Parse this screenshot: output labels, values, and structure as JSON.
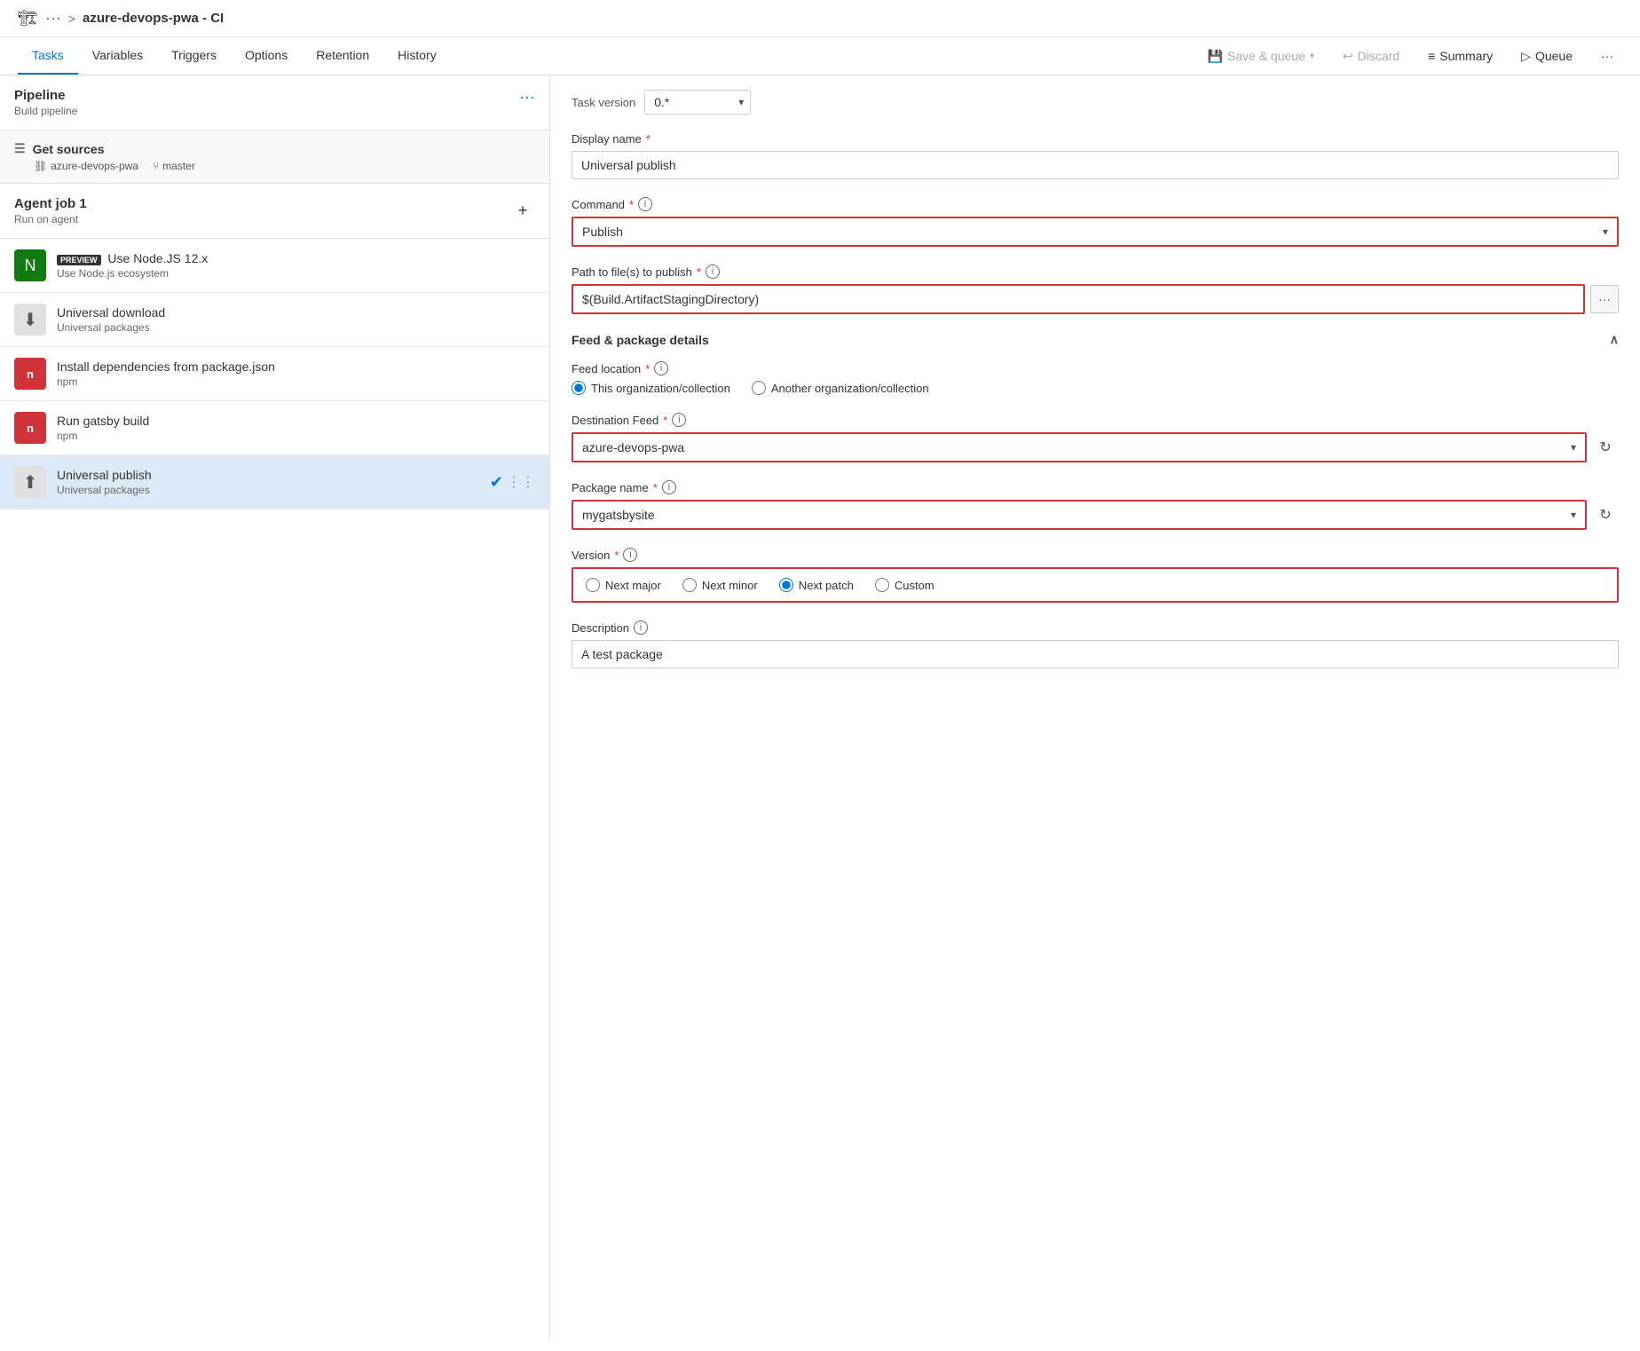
{
  "breadcrumb": {
    "icon": "🏠",
    "dots": "···",
    "separator": ">",
    "title": "azure-devops-pwa - CI"
  },
  "tabs": {
    "left": [
      {
        "id": "tasks",
        "label": "Tasks",
        "active": true
      },
      {
        "id": "variables",
        "label": "Variables",
        "active": false
      },
      {
        "id": "triggers",
        "label": "Triggers",
        "active": false
      },
      {
        "id": "options",
        "label": "Options",
        "active": false
      },
      {
        "id": "retention",
        "label": "Retention",
        "active": false
      },
      {
        "id": "history",
        "label": "History",
        "active": false
      }
    ],
    "right": [
      {
        "id": "save-queue",
        "label": "Save & queue",
        "icon": "💾",
        "disabled": true
      },
      {
        "id": "discard",
        "label": "Discard",
        "icon": "↩",
        "disabled": true
      },
      {
        "id": "summary",
        "label": "Summary",
        "icon": "≡"
      },
      {
        "id": "queue",
        "label": "Queue",
        "icon": "▷"
      },
      {
        "id": "more",
        "label": "···",
        "icon": ""
      }
    ]
  },
  "left_panel": {
    "pipeline": {
      "title": "Pipeline",
      "subtitle": "Build pipeline",
      "dots": "···"
    },
    "get_sources": {
      "title": "Get sources",
      "repo": "azure-devops-pwa",
      "branch": "master"
    },
    "agent_job": {
      "title": "Agent job 1",
      "subtitle": "Run on agent"
    },
    "tasks": [
      {
        "id": "nodejs",
        "name": "Use Node.JS 12.x",
        "subtitle": "Use Node.js ecosystem",
        "icon_type": "green",
        "icon": "N",
        "preview": true
      },
      {
        "id": "universal-download",
        "name": "Universal download",
        "subtitle": "Universal packages",
        "icon_type": "gray",
        "icon": "⬇",
        "preview": false
      },
      {
        "id": "install-deps",
        "name": "Install dependencies from package.json",
        "subtitle": "npm",
        "icon_type": "red",
        "icon": "n",
        "preview": false
      },
      {
        "id": "gatsby-build",
        "name": "Run gatsby build",
        "subtitle": "npm",
        "icon_type": "red",
        "icon": "n",
        "preview": false
      },
      {
        "id": "universal-publish",
        "name": "Universal publish",
        "subtitle": "Universal packages",
        "icon_type": "gray",
        "icon": "⬆",
        "preview": false,
        "active": true
      }
    ]
  },
  "right_panel": {
    "task_version_label": "Task version",
    "task_version_value": "0.*",
    "display_name_label": "Display name",
    "display_name_required": true,
    "display_name_value": "Universal publish",
    "command_label": "Command",
    "command_required": true,
    "command_value": "Publish",
    "path_label": "Path to file(s) to publish",
    "path_required": true,
    "path_value": "$(Build.ArtifactStagingDirectory)",
    "feed_section_title": "Feed & package details",
    "feed_location_label": "Feed location",
    "feed_location_required": true,
    "feed_location_options": [
      {
        "id": "this-org",
        "label": "This organization/collection",
        "checked": true
      },
      {
        "id": "another-org",
        "label": "Another organization/collection",
        "checked": false
      }
    ],
    "destination_feed_label": "Destination Feed",
    "destination_feed_required": true,
    "destination_feed_value": "azure-devops-pwa",
    "package_name_label": "Package name",
    "package_name_required": true,
    "package_name_value": "mygatsbysite",
    "version_label": "Version",
    "version_required": true,
    "version_options": [
      {
        "id": "next-major",
        "label": "Next major",
        "checked": false
      },
      {
        "id": "next-minor",
        "label": "Next minor",
        "checked": false
      },
      {
        "id": "next-patch",
        "label": "Next patch",
        "checked": true
      },
      {
        "id": "custom",
        "label": "Custom",
        "checked": false
      }
    ],
    "description_label": "Description",
    "description_value": "A test package"
  }
}
